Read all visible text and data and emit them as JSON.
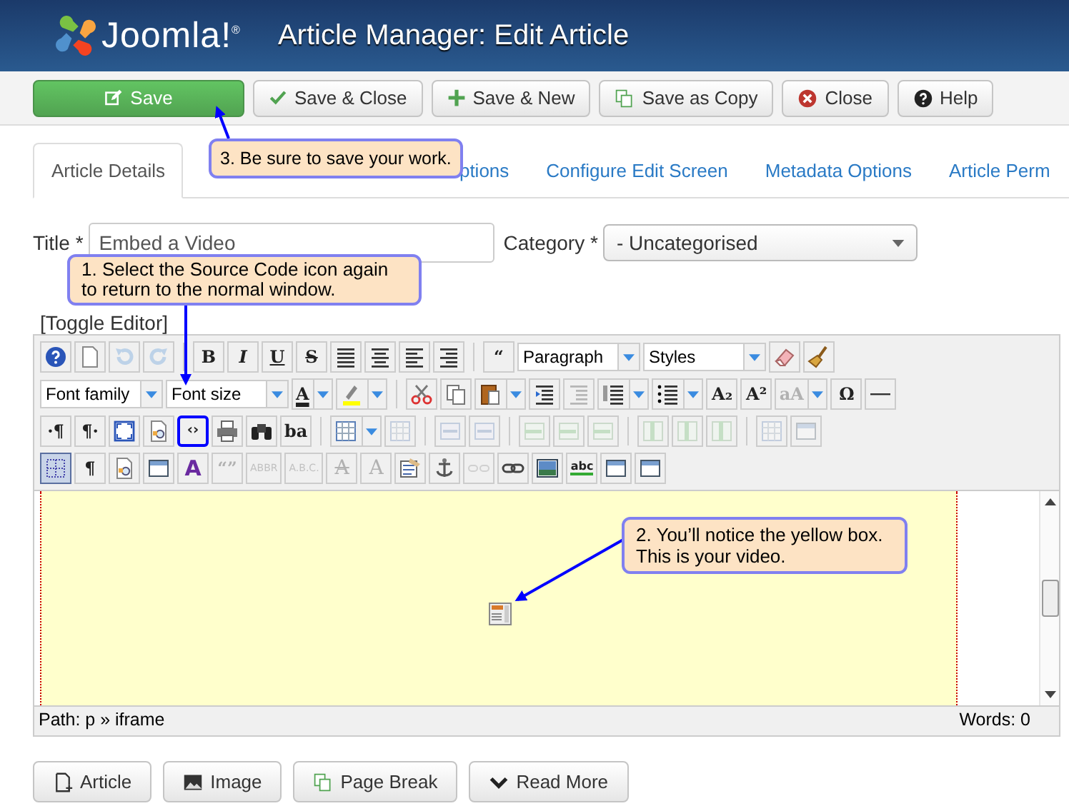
{
  "header": {
    "logo": "Joomla!$^{®}$",
    "title": "Article Manager: Edit Article"
  },
  "actions": [
    {
      "kind": "save",
      "label": "Save"
    },
    {
      "kind": "check",
      "label": "Save & Close"
    },
    {
      "kind": "plus",
      "label": "Save & New"
    },
    {
      "kind": "copy",
      "label": "Save as Copy"
    },
    {
      "kind": "close",
      "label": "Close"
    },
    {
      "kind": "help",
      "label": "Help"
    }
  ],
  "tabs": [
    {
      "label": "Article Details",
      "selected": true
    },
    {
      "label": "ptions",
      "selected": false
    },
    {
      "label": "Configure Edit Screen",
      "selected": false
    },
    {
      "label": "Metadata Options",
      "selected": false
    },
    {
      "label": "Article Perm",
      "selected": false
    }
  ],
  "title_field": {
    "label": "Title *",
    "value": "Embed a Video"
  },
  "category_field": {
    "label": "Category *",
    "value": "- Uncategorised"
  },
  "toggle_editor": "[Toggle Editor]",
  "toolbar": [
    [
      {
        "kind": "help",
        "disabled": false
      },
      {
        "kind": "new",
        "disabled": false
      },
      {
        "kind": "undo",
        "disabled": true
      },
      {
        "kind": "redo",
        "disabled": true
      },
      {
        "kind": "sep"
      },
      {
        "kind": "bold",
        "glyph": "B",
        "disabled": false
      },
      {
        "kind": "italic",
        "glyph": "I",
        "disabled": false
      },
      {
        "kind": "underline",
        "glyph": "U",
        "disabled": false
      },
      {
        "kind": "strike",
        "glyph": "S",
        "disabled": false
      },
      {
        "kind": "justify",
        "disabled": false
      },
      {
        "kind": "center",
        "disabled": false
      },
      {
        "kind": "left",
        "disabled": false
      },
      {
        "kind": "right",
        "disabled": false
      },
      {
        "kind": "sep"
      },
      {
        "kind": "quote",
        "glyph": "“",
        "disabled": false
      },
      {
        "kind": "select",
        "value": "Paragraph"
      },
      {
        "kind": "select",
        "value": "Styles"
      },
      {
        "kind": "eraser",
        "disabled": false
      },
      {
        "kind": "broom",
        "disabled": false
      }
    ],
    [
      {
        "kind": "select",
        "value": "Font family"
      },
      {
        "kind": "select",
        "value": "Font size"
      },
      {
        "kind": "textcolor",
        "glyph": "A",
        "menu": true,
        "disabled": false
      },
      {
        "kind": "highlight",
        "menu": true,
        "disabled": false
      },
      {
        "kind": "sep"
      },
      {
        "kind": "cut",
        "disabled": false
      },
      {
        "kind": "copy",
        "disabled": false
      },
      {
        "kind": "paste",
        "menu": true,
        "disabled": false
      },
      {
        "kind": "indent",
        "disabled": false
      },
      {
        "kind": "outdent",
        "disabled": true
      },
      {
        "kind": "ol",
        "menu": true,
        "disabled": false
      },
      {
        "kind": "ul",
        "menu": true,
        "disabled": false
      },
      {
        "kind": "sub",
        "glyph": "A₂",
        "disabled": false
      },
      {
        "kind": "sup",
        "glyph": "A²",
        "disabled": false
      },
      {
        "kind": "case",
        "glyph": "aA",
        "menu": true,
        "disabled": true
      },
      {
        "kind": "omega",
        "glyph": "Ω",
        "disabled": false
      },
      {
        "kind": "hr",
        "disabled": false
      }
    ],
    [
      {
        "kind": "ltr",
        "glyph": "·¶",
        "disabled": false
      },
      {
        "kind": "rtl",
        "glyph": "¶·",
        "disabled": false
      },
      {
        "kind": "fullscreen",
        "disabled": false
      },
      {
        "kind": "preview",
        "disabled": false
      },
      {
        "kind": "code",
        "glyph": "‹›",
        "disabled": false,
        "highlighted": true
      },
      {
        "kind": "print",
        "disabled": false
      },
      {
        "kind": "find",
        "disabled": false
      },
      {
        "kind": "replace",
        "glyph": "ba",
        "disabled": false
      },
      {
        "kind": "sep"
      },
      {
        "kind": "table",
        "menu": true,
        "disabled": false
      },
      {
        "kind": "table",
        "disabled": true
      },
      {
        "kind": "sep"
      },
      {
        "kind": "row",
        "disabled": true
      },
      {
        "kind": "row",
        "disabled": true
      },
      {
        "kind": "sep"
      },
      {
        "kind": "rowop",
        "disabled": true
      },
      {
        "kind": "rowop",
        "disabled": true
      },
      {
        "kind": "rowop",
        "disabled": true
      },
      {
        "kind": "sep"
      },
      {
        "kind": "col",
        "disabled": true
      },
      {
        "kind": "col",
        "disabled": true
      },
      {
        "kind": "col",
        "disabled": true
      },
      {
        "kind": "sep"
      },
      {
        "kind": "table",
        "disabled": true
      },
      {
        "kind": "window",
        "disabled": true
      }
    ],
    [
      {
        "kind": "visualaid",
        "disabled": false,
        "highlighted": false,
        "selected": true
      },
      {
        "kind": "blocks",
        "glyph": "¶",
        "disabled": false
      },
      {
        "kind": "preview",
        "disabled": false
      },
      {
        "kind": "window",
        "disabled": false
      },
      {
        "kind": "style",
        "glyph": "A",
        "disabled": false
      },
      {
        "kind": "cite",
        "glyph": "“”",
        "disabled": true
      },
      {
        "kind": "abbr",
        "glyph": "ABBR",
        "disabled": true
      },
      {
        "kind": "abbr",
        "glyph": "A.B.C.",
        "disabled": true
      },
      {
        "kind": "del",
        "glyph": "A",
        "disabled": true
      },
      {
        "kind": "ins",
        "glyph": "A",
        "disabled": true
      },
      {
        "kind": "form",
        "disabled": false
      },
      {
        "kind": "anchor",
        "disabled": false
      },
      {
        "kind": "unlink",
        "disabled": true
      },
      {
        "kind": "link",
        "disabled": false
      },
      {
        "kind": "image",
        "disabled": false
      },
      {
        "kind": "spell",
        "glyph": "abc",
        "disabled": false
      },
      {
        "kind": "window",
        "disabled": false
      },
      {
        "kind": "window",
        "disabled": false
      }
    ]
  ],
  "status": {
    "path": "Path:  p » iframe",
    "words": "Words: 0"
  },
  "buttons": [
    {
      "kind": "article",
      "label": "Article"
    },
    {
      "kind": "image",
      "label": "Image"
    },
    {
      "kind": "pagebreak",
      "label": "Page Break"
    },
    {
      "kind": "readmore",
      "label": "Read More"
    }
  ],
  "callouts": [
    "3. Be sure to save your work.",
    "1. Select the Source Code icon again to return to the normal window.",
    "2. You’ll notice the yellow box. This is your video."
  ]
}
